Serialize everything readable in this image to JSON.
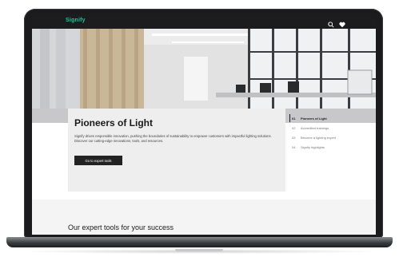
{
  "header": {
    "logo": "Signify",
    "icons": [
      "search-icon",
      "heart-icon"
    ]
  },
  "hero": {
    "title": "Pioneers of Light",
    "description": "Signify drives responsible innovation, pushing the boundaries of sustainability to empower customers with impactful lighting solutions. Discover our cutting-edge innovations, tools, and resources.",
    "cta_label": "Go to expert tools"
  },
  "toc": {
    "items": [
      {
        "num": "01",
        "label": "Pioneers of Light",
        "active": true
      },
      {
        "num": "02",
        "label": "Accredited trainings",
        "active": false
      },
      {
        "num": "03",
        "label": "Become a lighting expert",
        "active": false
      },
      {
        "num": "04",
        "label": "Signify highlights",
        "active": false
      }
    ]
  },
  "section": {
    "title": "Our expert tools for your success"
  },
  "colors": {
    "brand": "#21c29a",
    "topbar": "#1c1c1f",
    "button": "#222222"
  }
}
